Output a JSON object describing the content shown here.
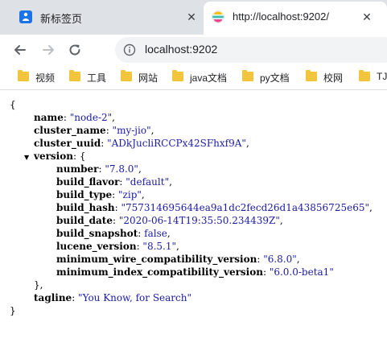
{
  "tabs": [
    {
      "title": "新标签页",
      "close": "✕",
      "icon": "new-tab-icon"
    },
    {
      "title": "http://localhost:9202/",
      "close": "✕",
      "icon": "elastic-icon"
    }
  ],
  "toolbar": {
    "url": "localhost:9202",
    "back_icon": "back-arrow-icon",
    "forward_icon": "forward-arrow-icon",
    "reload_icon": "reload-icon",
    "info_icon": "info-icon"
  },
  "bookmarks": [
    "视频",
    "工具",
    "网站",
    "java文档",
    "py文档",
    "校网",
    "TJ"
  ],
  "json": {
    "open": "{",
    "close": "}",
    "name_key": "name",
    "name_val": "\"node-2\"",
    "cluster_name_key": "cluster_name",
    "cluster_name_val": "\"my-jio\"",
    "cluster_uuid_key": "cluster_uuid",
    "cluster_uuid_val": "\"ADkJucliRCCPx42SFhxf9A\"",
    "version_key": "version",
    "version_open": "{",
    "number_key": "number",
    "number_val": "\"7.8.0\"",
    "build_flavor_key": "build_flavor",
    "build_flavor_val": "\"default\"",
    "build_type_key": "build_type",
    "build_type_val": "\"zip\"",
    "build_hash_key": "build_hash",
    "build_hash_val": "\"757314695644ea9a1dc2fecd26d1a43856725e65\"",
    "build_date_key": "build_date",
    "build_date_val": "\"2020-06-14T19:35:50.234439Z\"",
    "build_snapshot_key": "build_snapshot",
    "build_snapshot_val": "false",
    "lucene_version_key": "lucene_version",
    "lucene_version_val": "\"8.5.1\"",
    "min_wire_key": "minimum_wire_compatibility_version",
    "min_wire_val": "\"6.8.0\"",
    "min_index_key": "minimum_index_compatibility_version",
    "min_index_val": "\"6.0.0-beta1\"",
    "version_close": "},",
    "tagline_key": "tagline",
    "tagline_val": "\"You Know, for Search\""
  }
}
